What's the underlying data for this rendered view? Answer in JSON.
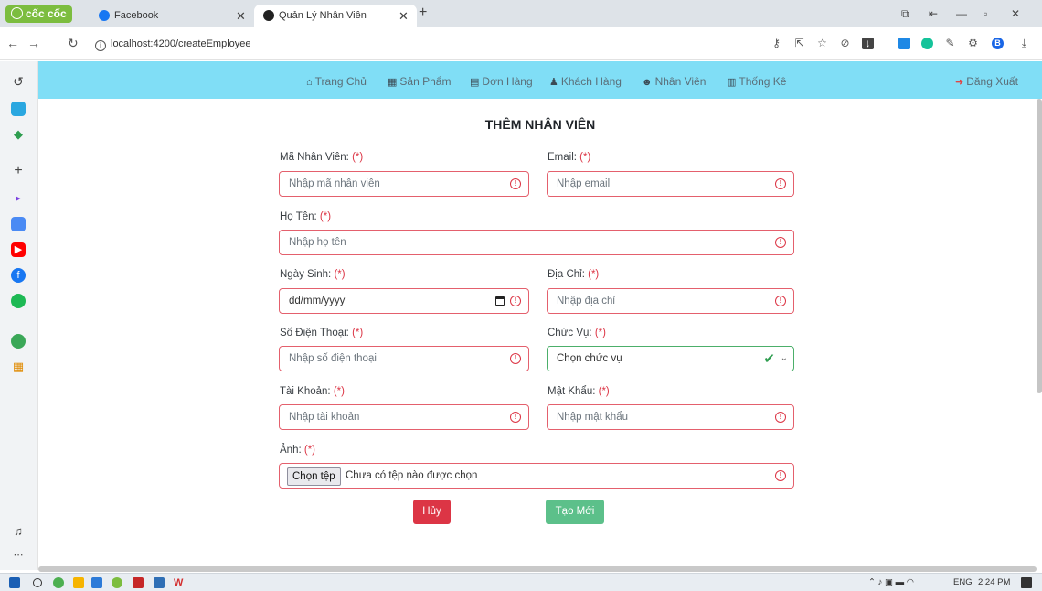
{
  "browser": {
    "brand": "cốc cốc",
    "tabs": [
      {
        "title": "Facebook",
        "icon": "facebook-icon"
      },
      {
        "title": "Quản Lý Nhân Viên",
        "icon": "app-icon",
        "active": true
      }
    ],
    "url": "localhost:4200/createEmployee",
    "profile_initial": "B"
  },
  "navbar": {
    "items": [
      {
        "label": "Trang Chủ",
        "icon": "home-icon"
      },
      {
        "label": "Sản Phẩm",
        "icon": "grid-icon"
      },
      {
        "label": "Đơn Hàng",
        "icon": "file-icon"
      },
      {
        "label": "Khách Hàng",
        "icon": "person-icon"
      },
      {
        "label": "Nhân Viên",
        "icon": "users-icon"
      },
      {
        "label": "Thống Kê",
        "icon": "chart-icon"
      }
    ],
    "logout": "Đăng Xuất"
  },
  "form": {
    "title": "THÊM NHÂN VIÊN",
    "required_mark": "(*)",
    "fields": {
      "ma": {
        "label": "Mã Nhân Viên:",
        "placeholder": "Nhập mã nhân viên"
      },
      "email": {
        "label": "Email:",
        "placeholder": "Nhập email"
      },
      "hoten": {
        "label": "Họ Tên:",
        "placeholder": "Nhập họ tên"
      },
      "ngaysinh": {
        "label": "Ngày Sinh:",
        "placeholder": "dd/mm/yyyy"
      },
      "diachi": {
        "label": "Địa Chỉ:",
        "placeholder": "Nhập địa chỉ"
      },
      "sdt": {
        "label": "Số Điện Thoại:",
        "placeholder": "Nhập số điện thoại"
      },
      "chucvu": {
        "label": "Chức Vụ:",
        "value": "Chọn chức vụ"
      },
      "taikhoan": {
        "label": "Tài Khoản:",
        "placeholder": "Nhập tài khoản"
      },
      "matkhau": {
        "label": "Mật Khẩu:",
        "placeholder": "Nhập mật khẩu"
      },
      "anh": {
        "label": "Ảnh:",
        "button": "Chọn tệp",
        "status": "Chưa có tệp nào được chọn"
      }
    },
    "cancel": "Hủy",
    "create": "Tạo Mới"
  },
  "taskbar": {
    "language": "ENG",
    "time": "2:24 PM"
  },
  "colors": {
    "navbar": "#80def6",
    "invalid": "#dc3545",
    "valid": "#4caf6a",
    "create_button": "#5cc08a"
  }
}
